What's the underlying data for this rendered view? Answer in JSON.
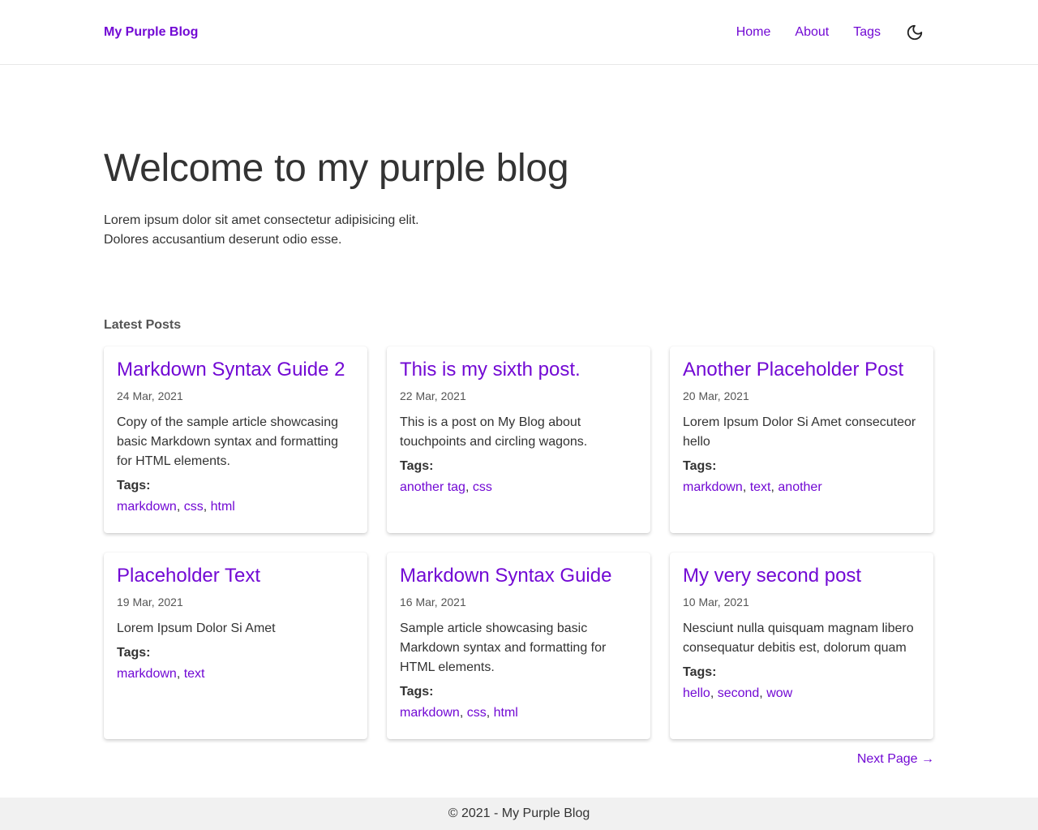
{
  "header": {
    "brand": "My Purple Blog",
    "nav": [
      {
        "label": "Home"
      },
      {
        "label": "About"
      },
      {
        "label": "Tags"
      }
    ],
    "theme_toggle_icon": "moon-icon"
  },
  "hero": {
    "title": "Welcome to my purple blog",
    "description_lines": [
      "Lorem ipsum dolor sit amet consectetur adipisicing elit.",
      "Dolores accusantium deserunt odio esse."
    ]
  },
  "latest": {
    "heading": "Latest Posts",
    "tags_label": "Tags:",
    "posts": [
      {
        "title": "Markdown Syntax Guide 2",
        "date": "24 Mar, 2021",
        "summary": "Copy of the sample article showcasing basic Markdown syntax and formatting for HTML elements.",
        "tags": [
          "markdown",
          "css",
          "html"
        ]
      },
      {
        "title": "This is my sixth post.",
        "date": "22 Mar, 2021",
        "summary": "This is a post on My Blog about touchpoints and circling wagons.",
        "tags": [
          "another tag",
          "css"
        ]
      },
      {
        "title": "Another Placeholder Post",
        "date": "20 Mar, 2021",
        "summary": "Lorem Ipsum Dolor Si Amet consecuteor hello",
        "tags": [
          "markdown",
          "text",
          "another"
        ]
      },
      {
        "title": "Placeholder Text",
        "date": "19 Mar, 2021",
        "summary": "Lorem Ipsum Dolor Si Amet",
        "tags": [
          "markdown",
          "text"
        ]
      },
      {
        "title": "Markdown Syntax Guide",
        "date": "16 Mar, 2021",
        "summary": "Sample article showcasing basic Markdown syntax and formatting for HTML elements.",
        "tags": [
          "markdown",
          "css",
          "html"
        ]
      },
      {
        "title": "My very second post",
        "date": "10 Mar, 2021",
        "summary": "Nesciunt nulla quisquam magnam libero consequatur debitis est, dolorum quam",
        "tags": [
          "hello",
          "second",
          "wow"
        ]
      }
    ]
  },
  "pagination": {
    "next_label": "Next Page →"
  },
  "footer": {
    "text": "© 2021 - My Purple Blog"
  },
  "colors": {
    "accent": "#7209d4",
    "text": "#333333",
    "muted": "#555555",
    "footer_bg": "#f1f1f1",
    "border": "#e8e8e8"
  }
}
